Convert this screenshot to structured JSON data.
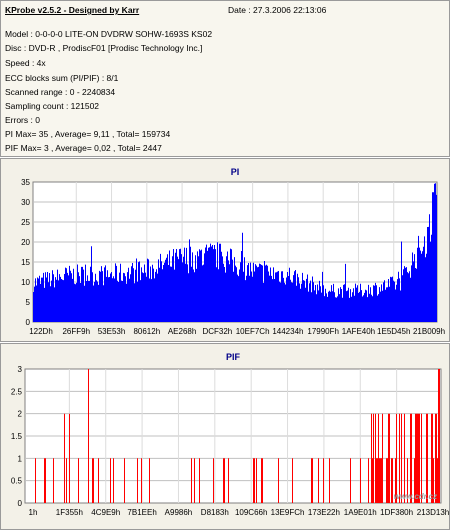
{
  "info": {
    "title": "KProbe v2.5.2 - Designed by Karr",
    "date": "Date : 27.3.2006 22:13:06",
    "lines": [
      "Model : 0-0-0-0 LITE-ON DVDRW SOHW-1693S KS02",
      "Disc : DVD-R , ProdiscF01 [Prodisc Technology Inc.]",
      "Speed : 4x",
      "ECC blocks sum (PI/PIF) : 8/1",
      "Scanned range : 0 - 2240834",
      "Sampling count : 121502",
      "Errors : 0",
      "PI Max= 35 , Average= 9,11 , Total= 159734",
      "PIF Max= 3 , Average= 0,02 , Total= 2447"
    ]
  },
  "colors": {
    "pi": "#0000ff",
    "pif": "#ff0000",
    "title": "#000088",
    "bg": "#ffffff"
  },
  "pi_chart": {
    "title": "PI",
    "ytick_labels": [
      "35",
      "30",
      "25",
      "20",
      "15",
      "10",
      "5",
      "0"
    ],
    "xtick_labels": [
      "122Dh",
      "26FF9h",
      "53E53h",
      "80612h",
      "AE268h",
      "DCF32h",
      "10EF7Ch",
      "144234h",
      "17990Fh",
      "1AFE40h",
      "1E5D45h",
      "21B009h"
    ]
  },
  "pif_chart": {
    "title": "PIF",
    "ytick_labels": [
      "3",
      "2.5",
      "2",
      "1.5",
      "1",
      "0.5",
      "0"
    ],
    "xtick_labels": [
      "1h",
      "1F355h",
      "4C9E9h",
      "7B1EEh",
      "A9986h",
      "D8183h",
      "109C66h",
      "13E9FCh",
      "173E22h",
      "1A9E01h",
      "1DF380h",
      "213D13h"
    ]
  },
  "watermark": "www.cdr.cz",
  "chart_data": [
    {
      "type": "bar",
      "title": "PI",
      "xlabel": "",
      "ylabel": "",
      "ylim": [
        0,
        35
      ],
      "grid": true,
      "categories": [
        "122Dh",
        "26FF9h",
        "53E53h",
        "80612h",
        "AE268h",
        "DCF32h",
        "10EF7Ch",
        "144234h",
        "17990Fh",
        "1AFE40h",
        "1E5D45h",
        "21B009h"
      ],
      "values": [
        10,
        12,
        12,
        13,
        16,
        17,
        13,
        12,
        8,
        8,
        10,
        26
      ],
      "max": 35,
      "average": 9.11
    },
    {
      "type": "bar",
      "title": "PIF",
      "xlabel": "",
      "ylabel": "",
      "ylim": [
        0,
        3
      ],
      "grid": true,
      "categories": [
        "1h",
        "1F355h",
        "4C9E9h",
        "7B1EEh",
        "A9986h",
        "D8183h",
        "109C66h",
        "13E9FCh",
        "173E22h",
        "1A9E01h",
        "1DF380h",
        "213D13h"
      ],
      "values": [
        1,
        1,
        3,
        0,
        1,
        1,
        1,
        1,
        1,
        1,
        2,
        3
      ],
      "max": 3,
      "average": 0.02
    }
  ]
}
